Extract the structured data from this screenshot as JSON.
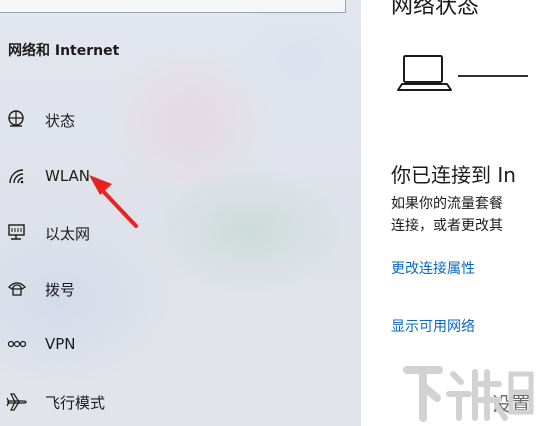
{
  "sidebar": {
    "section_title": "网络和 Internet",
    "items": [
      {
        "label": "状态",
        "icon": "status-globe-icon"
      },
      {
        "label": "WLAN",
        "icon": "wifi-icon"
      },
      {
        "label": "以太网",
        "icon": "ethernet-icon"
      },
      {
        "label": "拨号",
        "icon": "dialup-icon"
      },
      {
        "label": "VPN",
        "icon": "vpn-icon"
      },
      {
        "label": "飞行模式",
        "icon": "airplane-icon"
      }
    ]
  },
  "main": {
    "title_partial": "网络状态",
    "connected_heading": "你已连接到 In",
    "description_lines": [
      "如果你的流量套餐",
      "连接，或者更改其"
    ],
    "links": {
      "change_adapter": "更改连接属性",
      "show_networks": "显示可用网络"
    },
    "bottom_partial": "设置"
  },
  "annotation": {
    "arrow_color": "#e8231f"
  },
  "colors": {
    "accent_link": "#0a68c2",
    "sidebar_bg": "#e2e4ea"
  },
  "watermark": {
    "text": "下载吧"
  }
}
